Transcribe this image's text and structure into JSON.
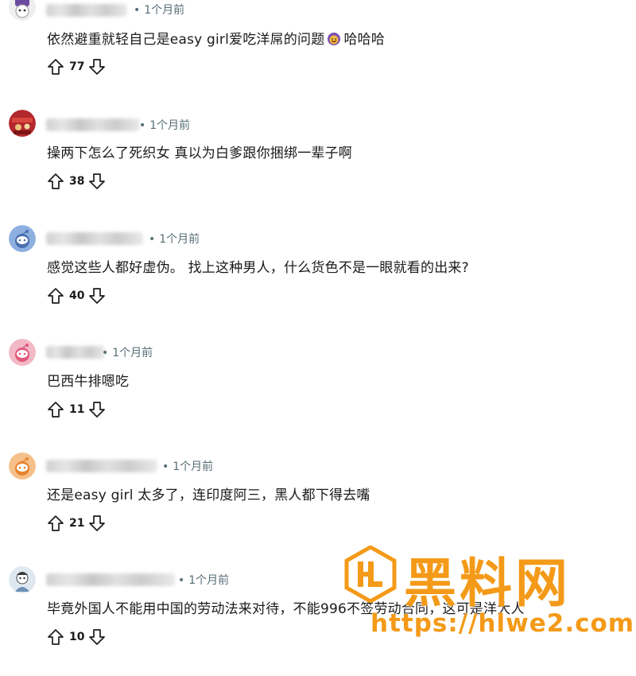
{
  "comments": [
    {
      "time": "1个月前",
      "text": "依然避重就轻自己是easy girl爱吃洋屌的问题",
      "text_suffix": "哈哈哈",
      "votes": "77",
      "avatar": "avatar-purple-hat"
    },
    {
      "time": "1个月前",
      "text": "操两下怎么了死织女 真以为白爹跟你捆绑一辈子啊",
      "votes": "38",
      "avatar": "avatar-red-photo"
    },
    {
      "time": "1个月前",
      "text": "感觉这些人都好虚伪。 找上这种男人，什么货色不是一眼就看的出来?",
      "votes": "40",
      "avatar": "avatar-blue-snoo"
    },
    {
      "time": "1个月前",
      "text": "巴西牛排嗯吃",
      "votes": "11",
      "avatar": "avatar-pink-snoo"
    },
    {
      "time": "1个月前",
      "text": "还是easy girl 太多了，连印度阿三，黑人都下得去嘴",
      "votes": "21",
      "avatar": "avatar-orange-snoo"
    },
    {
      "time": "1个月前",
      "text": "毕竟外国人不能用中国的劳动法来对待，不能996不签劳动合同，这可是洋大人",
      "votes": "10",
      "avatar": "avatar-cartoon-person"
    }
  ],
  "watermark": {
    "title": "黑料网",
    "url": "https://hlwe2.com",
    "logo_icon": "hl-logo-icon"
  },
  "colors": {
    "meta": "#576f76",
    "text": "#1a1a1b",
    "watermark": "#f49a18"
  }
}
